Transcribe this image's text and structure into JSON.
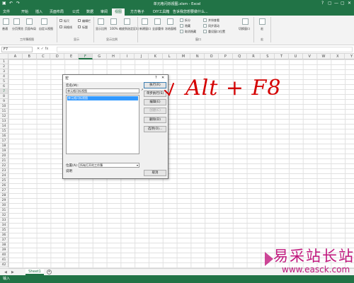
{
  "titlebar": {
    "title": "单元格闪烁视图.xlsm - Excel",
    "qat_icons": [
      "save-icon",
      "undo-icon",
      "redo-icon"
    ],
    "window_controls": [
      "?",
      "▢",
      "—",
      "▢",
      "✕"
    ]
  },
  "ribbon": {
    "tabs": [
      "文件",
      "开始",
      "插入",
      "页面布局",
      "公式",
      "数据",
      "审阅",
      "视图",
      "方方格子",
      "DIY工具箱"
    ],
    "tell_me": "告诉我您想要做什么...",
    "workbook_views": {
      "group": "工作簿视图",
      "items": [
        "普通",
        "分页预览",
        "页面布局",
        "自定义视图"
      ]
    },
    "show": {
      "group": "显示",
      "items": [
        "标尺",
        "编辑栏",
        "网格线",
        "标题"
      ]
    },
    "zoom": {
      "group": "显示比例",
      "items": [
        "显示比例",
        "100%",
        "缩放到选定区域"
      ]
    },
    "window": {
      "group": "窗口",
      "items": [
        "新建窗口",
        "全部重排",
        "冻结窗格",
        "拆分",
        "隐藏",
        "取消隐藏",
        "并排查看",
        "同步滚动",
        "重设窗口位置",
        "切换窗口"
      ]
    },
    "macros": {
      "group": "宏",
      "items": [
        "宏"
      ]
    }
  },
  "formula_bar": {
    "name_box": "F7",
    "icons": [
      "✕",
      "✓",
      "fx"
    ],
    "value": ""
  },
  "grid": {
    "columns": [
      "A",
      "B",
      "C",
      "D",
      "E",
      "F",
      "G",
      "H",
      "I",
      "J",
      "K",
      "L",
      "M",
      "N",
      "O",
      "P",
      "Q",
      "R",
      "S",
      "T",
      "U",
      "V",
      "W",
      "X",
      "Y"
    ],
    "selected_column": "F",
    "rows": [
      "1",
      "2",
      "3",
      "4",
      "5",
      "6",
      "7",
      "8",
      "9",
      "10",
      "11",
      "12",
      "13",
      "14",
      "15",
      "16",
      "17",
      "18",
      "19",
      "20",
      "21",
      "22",
      "23",
      "24",
      "25",
      "26",
      "27",
      "28",
      "29",
      "30",
      "31",
      "32",
      "33",
      "34",
      "35",
      "36",
      "37",
      "38",
      "39",
      "40",
      "41",
      "42"
    ],
    "selected_row": "7"
  },
  "dialog": {
    "title": "宏",
    "help": "?",
    "close": "✕",
    "name_label": "宏名(M):",
    "name_value": "单元格闪烁视图",
    "list_items": [
      "单元格闪烁视图"
    ],
    "buttons": {
      "run": "执行(R)",
      "step": "单步执行(S)",
      "edit": "编辑(E)",
      "create": "创建(C)",
      "delete": "删除(D)",
      "options": "选项(O)...",
      "cancel": "取消"
    },
    "location_label": "位置(A):",
    "location_value": "所有打开的工作簿",
    "description_label": "说明"
  },
  "annotation": {
    "text": "Alt + F8",
    "color": "#d40000"
  },
  "sheets": {
    "tabs": [
      "Sheet1"
    ],
    "add": "+"
  },
  "status": {
    "text": "输入"
  },
  "watermark": {
    "big": "易采站长站",
    "small": "www.easck.com",
    "color": "#c0187d"
  },
  "colors": {
    "excel_green": "#217346",
    "selection_blue": "#3399ff"
  }
}
